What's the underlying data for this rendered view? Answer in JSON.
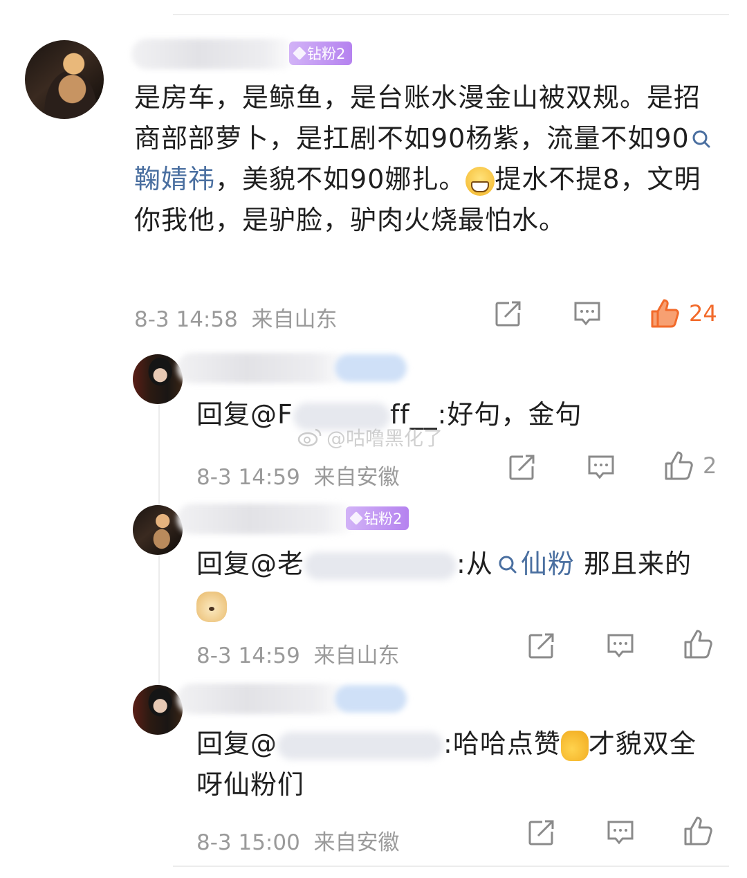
{
  "comment": {
    "badge": "钻粉2",
    "text_parts": [
      "是房车，是鲸鱼，是台账水漫金山被双规。是招商部部萝卜，是扛剧不如90杨紫，流量不如90",
      "鞠婧祎",
      "，美貌不如90娜扎。",
      "提水不提8，文明你我他，是驴脸，驴肉火烧最怕水。"
    ],
    "date": "8-3 14:58",
    "location": "来自山东",
    "likes": "24",
    "colors": {
      "liked": "#f26a2a",
      "badge": "#b582ef",
      "link": "#4a6fa0"
    }
  },
  "replies": [
    {
      "prefix": "回复@",
      "handle_visible": "F",
      "handle_tail": "ff__",
      "text": ":好句，金句",
      "date": "8-3 14:59",
      "location": "来自安徽",
      "likes": "2"
    },
    {
      "badge": "钻粉2",
      "prefix": "回复@",
      "handle_visible": "老",
      "text_before": ":从",
      "link": "仙粉",
      "text_after": " 那且来的",
      "date": "8-3 14:59",
      "location": "来自山东"
    },
    {
      "prefix": "回复@",
      "text_before": ":哈哈点赞",
      "text_after": "才貌双全呀仙粉们",
      "date": "8-3 15:00",
      "location": "来自安徽"
    }
  ],
  "watermark": "@咕噜黑化了",
  "icons": [
    "share-icon",
    "comment-icon",
    "like-icon",
    "search-icon"
  ]
}
